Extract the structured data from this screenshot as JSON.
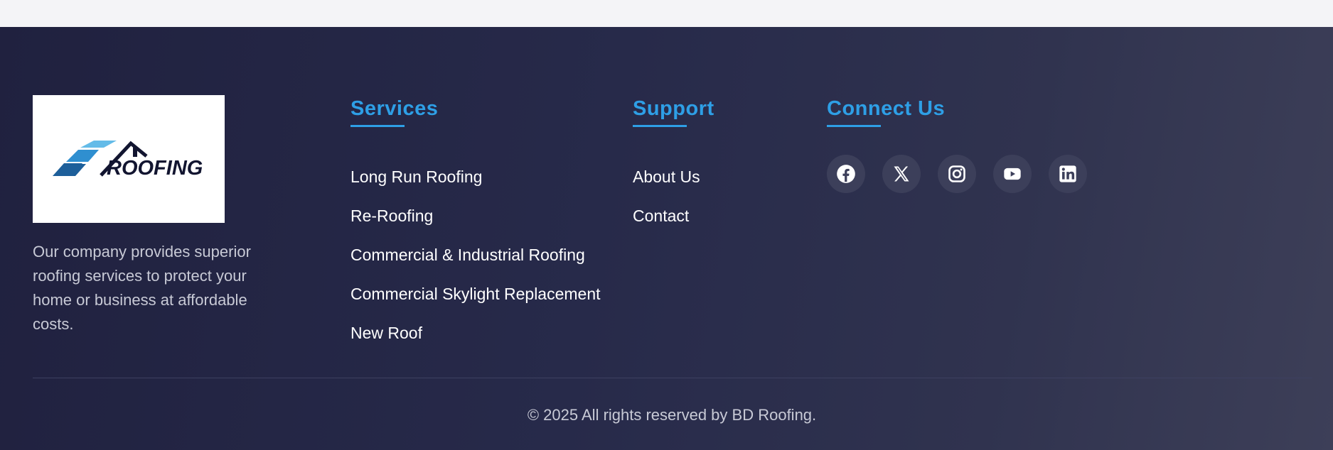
{
  "brand": {
    "logo_text": "ROOFING",
    "description": "Our company provides superior roofing services to protect your home or business at affordable costs."
  },
  "services": {
    "heading": "Services",
    "items": [
      "Long Run Roofing",
      "Re-Roofing",
      "Commercial & Industrial Roofing",
      "Commercial Skylight Replacement",
      "New Roof"
    ]
  },
  "support": {
    "heading": "Support",
    "items": [
      "About Us",
      "Contact"
    ]
  },
  "connect": {
    "heading": "Connect Us",
    "icons": [
      "facebook-icon",
      "x-icon",
      "instagram-icon",
      "youtube-icon",
      "linkedin-icon"
    ]
  },
  "footer": {
    "copyright": "© 2025 All rights reserved by BD Roofing."
  },
  "colors": {
    "accent": "#2e9fe6",
    "footer_bg": "#20213f",
    "social_bg": "#3c3f5a"
  }
}
